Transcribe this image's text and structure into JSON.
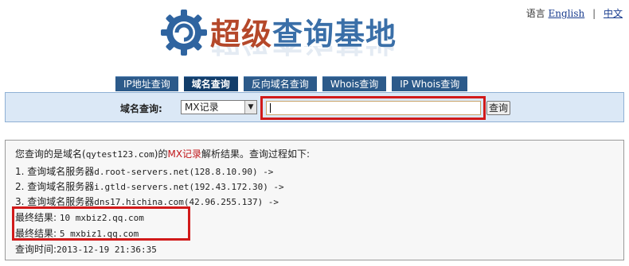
{
  "header": {
    "logo_text_part1": "超级",
    "logo_text_part2": "查询基地",
    "lang_label": "语言",
    "lang_english": "English",
    "lang_chinese": "中文"
  },
  "tabs": [
    {
      "label": "IP地址查询"
    },
    {
      "label": "域名查询"
    },
    {
      "label": "反向域名查询"
    },
    {
      "label": "Whois查询"
    },
    {
      "label": "IP  Whois查询"
    }
  ],
  "search": {
    "label": "域名查询:",
    "record_type": "MX记录",
    "input_value": "",
    "button_label": "查询"
  },
  "results": {
    "intro_prefix": "您查询的是域名(",
    "domain": "qytest123.com",
    "intro_mid": ")的",
    "record": "MX记录",
    "intro_suffix": "解析结果。查询过程如下:",
    "steps": [
      {
        "text": "1. 查询域名服务器",
        "server": "d.root-servers.net(128.8.10.90) ->"
      },
      {
        "text": "2. 查询域名服务器",
        "server": "i.gtld-servers.net(192.43.172.30) ->"
      },
      {
        "text": "3. 查询域名服务器",
        "server": "dns17.hichina.com(42.96.255.137) ->"
      }
    ],
    "finals": [
      {
        "label": "最终结果:",
        "value": "10 mxbiz2.qq.com"
      },
      {
        "label": "最终结果:",
        "value": "5 mxbiz1.qq.com"
      }
    ],
    "time_label": "查询时间:",
    "time_value": "2013-12-19 21:36:35"
  }
}
